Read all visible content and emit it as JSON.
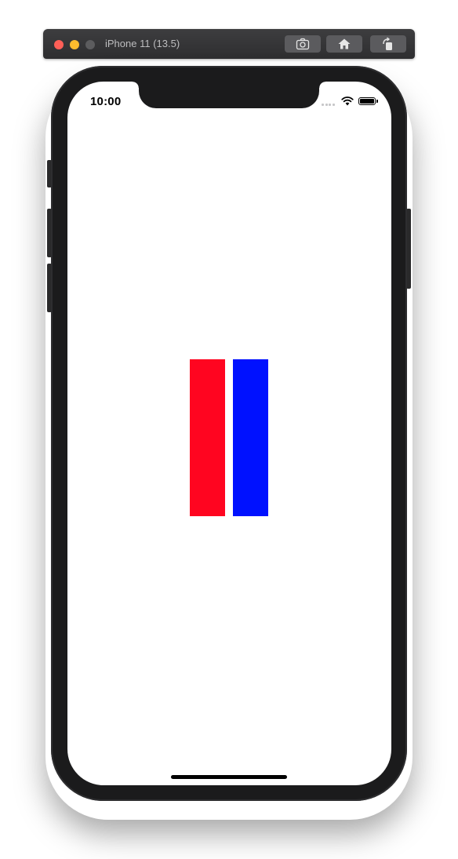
{
  "window": {
    "title": "iPhone 11 (13.5)",
    "buttons": [
      {
        "icon": "camera-icon",
        "label": "Screenshot"
      },
      {
        "icon": "home-icon",
        "label": "Home"
      },
      {
        "icon": "rotate-icon",
        "label": "Rotate"
      }
    ]
  },
  "status_bar": {
    "time": "10:00",
    "signal_icon": "signal-dots-icon",
    "wifi_icon": "wifi-icon",
    "battery_icon": "battery-icon",
    "battery_level": 1.0
  },
  "app": {
    "views": [
      {
        "name": "red-view",
        "color": "#ff0520"
      },
      {
        "name": "blue-view",
        "color": "#0011ff"
      }
    ]
  },
  "colors": {
    "screen_background": "#ffffff",
    "device_frame": "#1b1b1c",
    "close": "#fe5f57",
    "minimize": "#febc2e",
    "maximize_disabled": "#5c5c5e"
  }
}
